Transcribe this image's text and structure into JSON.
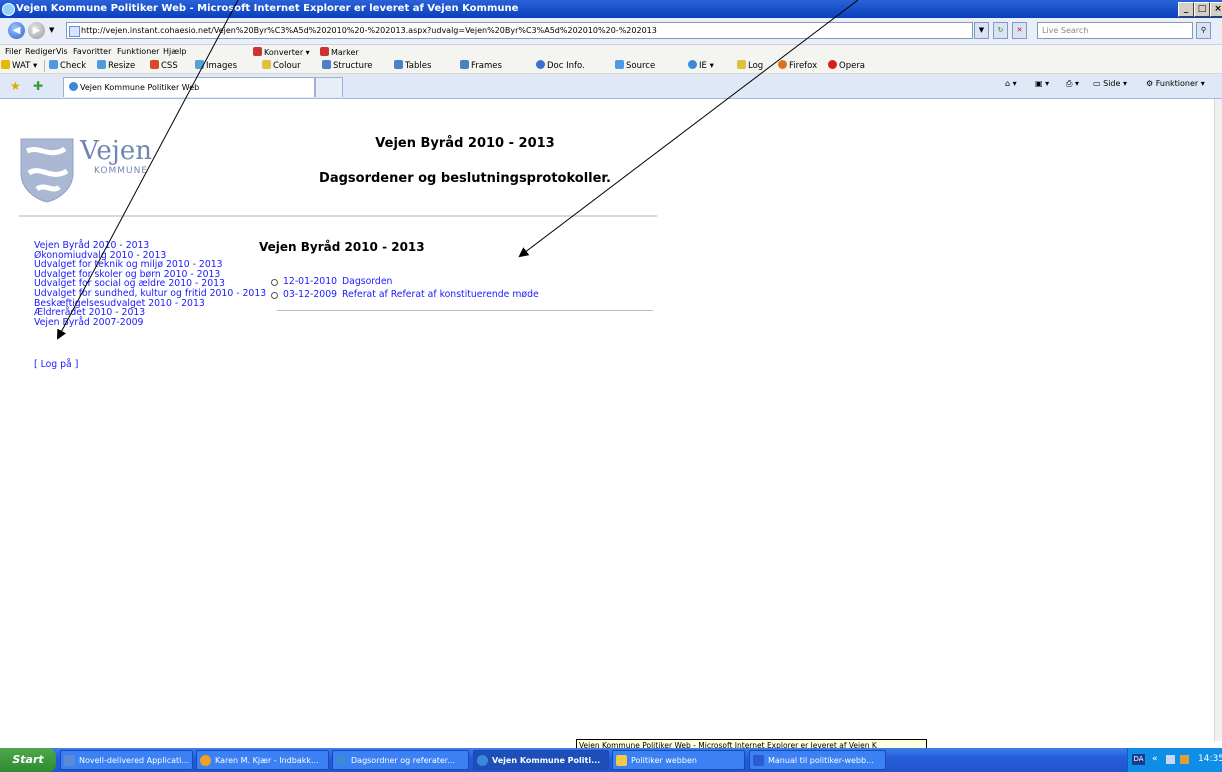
{
  "window": {
    "title": "Vejen Kommune Politiker Web - Microsoft Internet Explorer er leveret af Vejen Kommune",
    "minimize": "_",
    "maximize": "□",
    "close": "×"
  },
  "addressbar": {
    "url": "http://vejen.instant.cohaesio.net/Vejen%20Byr%C3%A5d%202010%20-%202013.aspx?udvalg=Vejen%20Byr%C3%A5d%202010%20-%202013",
    "search_placeholder": "Live Search"
  },
  "menu": {
    "items": [
      "Filer",
      "Rediger",
      "Vis",
      "Favoritter",
      "Funktioner",
      "Hjælp"
    ],
    "konverter": "Konverter",
    "marker": "Marker"
  },
  "toolbar": {
    "items": [
      "WAT",
      "Check",
      "Resize",
      "CSS",
      "Images",
      "Colour",
      "Structure",
      "Tables",
      "Frames",
      "Doc Info.",
      "Source",
      "IE",
      "Log",
      "Firefox",
      "Opera"
    ]
  },
  "tabs": {
    "active_label": "Vejen Kommune Politiker Web",
    "side": "Side",
    "funktioner": "Funktioner"
  },
  "logo": {
    "word": "Vejen",
    "sub": "KOMMUNE"
  },
  "page": {
    "heading": "Vejen Byråd 2010 - 2013",
    "subheading": "Dagsordener og beslutningsprotokoller.",
    "section_title": "Vejen Byråd 2010 - 2013",
    "nav": [
      "Vejen Byråd 2010 - 2013",
      "Økonomiudvalg 2010 - 2013",
      "Udvalget for teknik og miljø 2010 - 2013",
      "Udvalget for skoler og børn 2010 - 2013",
      "Udvalget for social og ældre 2010 - 2013",
      "Udvalget for sundhed, kultur og fritid 2010 - 2013",
      "Beskæftigelsesudvalget 2010 - 2013",
      "Ældrerådet 2010 - 2013",
      "Vejen Byråd 2007-2009"
    ],
    "login": "[ Log på ]",
    "documents": [
      {
        "date": "12-01-2010",
        "title": "Dagsorden"
      },
      {
        "date": "03-12-2009",
        "title": "Referat af Referat af konstituerende møde"
      }
    ]
  },
  "tooltip": "Vejen Kommune Politiker Web - Microsoft Internet Explorer er leveret af Vejen K",
  "taskbar": {
    "start": "Start",
    "tasks": [
      "Novell-delivered Applicati...",
      "Karen M. Kjær - Indbakk...",
      "Dagsordner og referater...",
      "Vejen Kommune Politi...",
      "Politiker webben",
      "Manual til politiker-webb..."
    ],
    "lang": "DA",
    "clock": "14:35"
  }
}
